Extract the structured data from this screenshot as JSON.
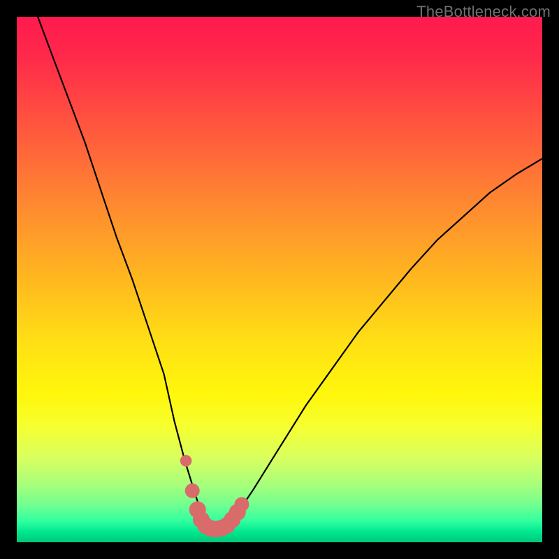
{
  "watermark": "TheBottleneck.com",
  "colors": {
    "frame": "#000000",
    "curve_stroke": "#000000",
    "marker_fill": "#d96b6b",
    "watermark": "#707070"
  },
  "chart_data": {
    "type": "line",
    "title": "",
    "xlabel": "",
    "ylabel": "",
    "xlim": [
      0,
      100
    ],
    "ylim": [
      0,
      100
    ],
    "grid": false,
    "legend": false,
    "note": "No axis ticks or numeric labels are visible in the image; values below are estimated from pixel positions on a 0–100 normalized scale.",
    "series": [
      {
        "name": "bottleneck-curve",
        "x": [
          4,
          7,
          10,
          13,
          16,
          19,
          22,
          25,
          28,
          30,
          32,
          34,
          35,
          36,
          37,
          38,
          40,
          42,
          45,
          50,
          55,
          60,
          65,
          70,
          75,
          80,
          85,
          90,
          95,
          100
        ],
        "y": [
          100,
          92,
          84,
          76,
          67,
          58,
          50,
          41,
          32,
          23,
          15.5,
          9,
          6,
          3.5,
          2.5,
          2.5,
          3,
          5.5,
          10,
          18,
          26,
          33,
          40,
          46,
          52,
          57.5,
          62,
          66.5,
          70,
          73
        ]
      }
    ],
    "markers": [
      {
        "name": "dot-left-upper",
        "x": 32.2,
        "y": 15.5,
        "r": 1.1
      },
      {
        "name": "cluster-1",
        "x": 33.4,
        "y": 9.8,
        "r": 1.4
      },
      {
        "name": "cluster-2",
        "x": 34.4,
        "y": 6.2,
        "r": 1.6
      },
      {
        "name": "cluster-3",
        "x": 35.1,
        "y": 4.3,
        "r": 1.6
      },
      {
        "name": "cluster-4",
        "x": 36.0,
        "y": 3.1,
        "r": 1.6
      },
      {
        "name": "cluster-5",
        "x": 37.0,
        "y": 2.6,
        "r": 1.6
      },
      {
        "name": "cluster-6",
        "x": 38.0,
        "y": 2.5,
        "r": 1.6
      },
      {
        "name": "cluster-7",
        "x": 39.0,
        "y": 2.7,
        "r": 1.6
      },
      {
        "name": "cluster-8",
        "x": 40.0,
        "y": 3.2,
        "r": 1.6
      },
      {
        "name": "cluster-9",
        "x": 41.0,
        "y": 4.3,
        "r": 1.6
      },
      {
        "name": "cluster-10",
        "x": 42.0,
        "y": 5.7,
        "r": 1.6
      },
      {
        "name": "cluster-11",
        "x": 42.8,
        "y": 7.2,
        "r": 1.4
      }
    ]
  }
}
